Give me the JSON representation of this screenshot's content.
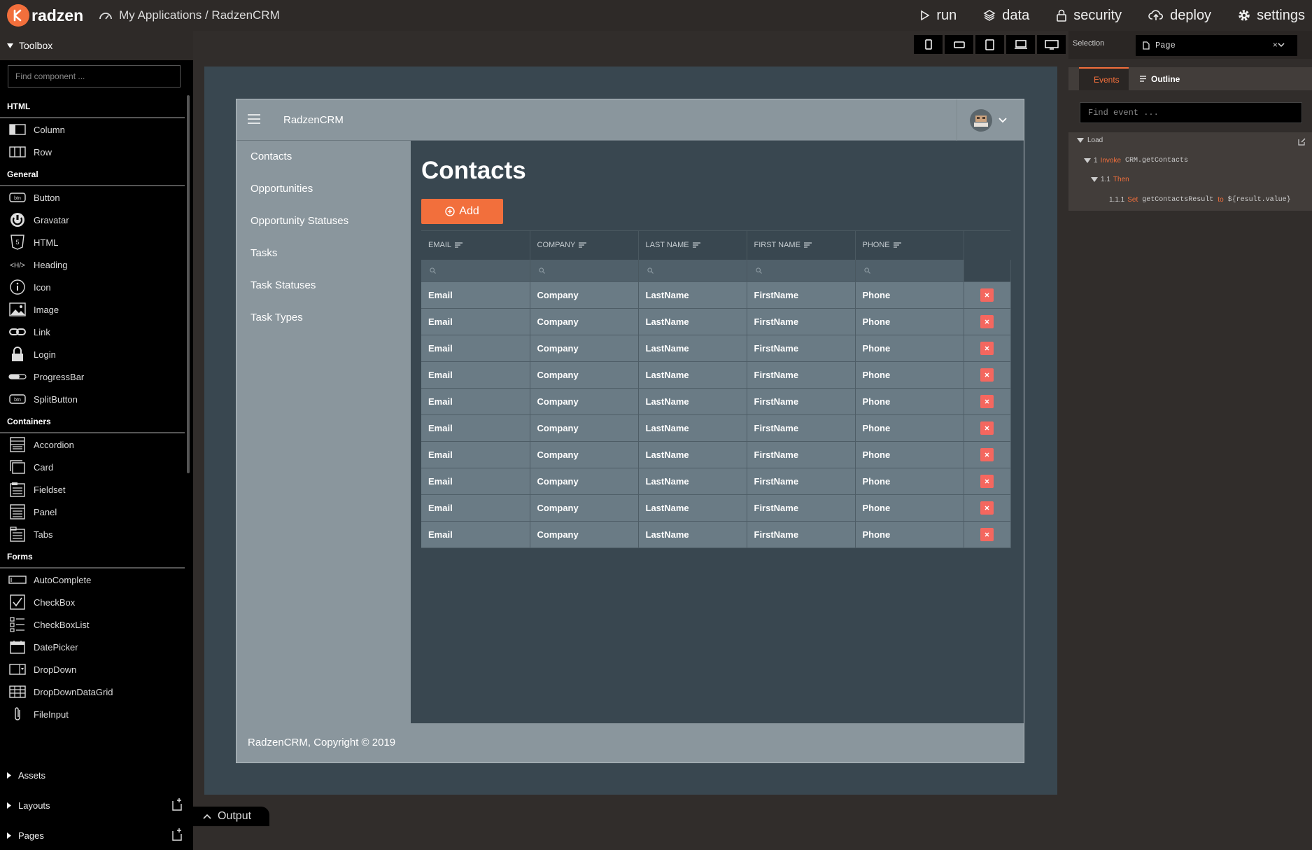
{
  "topbar": {
    "logo_text": "radzen",
    "breadcrumb": "My Applications / RadzenCRM",
    "nav": [
      {
        "label": "run",
        "icon": "play-icon"
      },
      {
        "label": "data",
        "icon": "layers-icon"
      },
      {
        "label": "security",
        "icon": "lock-icon"
      },
      {
        "label": "deploy",
        "icon": "cloud-upload-icon"
      },
      {
        "label": "settings",
        "icon": "gear-icon"
      }
    ]
  },
  "toolbox": {
    "title": "Toolbox",
    "search_placeholder": "Find component ...",
    "categories": [
      {
        "name": "HTML",
        "items": [
          "Column",
          "Row"
        ]
      },
      {
        "name": "General",
        "items": [
          "Button",
          "Gravatar",
          "HTML",
          "Heading",
          "Icon",
          "Image",
          "Link",
          "Login",
          "ProgressBar",
          "SplitButton"
        ]
      },
      {
        "name": "Containers",
        "items": [
          "Accordion",
          "Card",
          "Fieldset",
          "Panel",
          "Tabs"
        ]
      },
      {
        "name": "Forms",
        "items": [
          "AutoComplete",
          "CheckBox",
          "CheckBoxList",
          "DatePicker",
          "DropDown",
          "DropDownDataGrid",
          "FileInput"
        ]
      }
    ],
    "sections": [
      "Assets",
      "Layouts",
      "Pages"
    ]
  },
  "devices": [
    "phone-portrait-icon",
    "phone-landscape-icon",
    "tablet-icon",
    "laptop-icon",
    "desktop-icon"
  ],
  "app": {
    "title": "RadzenCRM",
    "nav": [
      "Contacts",
      "Opportunities",
      "Opportunity Statuses",
      "Tasks",
      "Task Statuses",
      "Task Types"
    ],
    "page_title": "Contacts",
    "add_label": "Add",
    "footer": "RadzenCRM, Copyright © 2019",
    "grid": {
      "columns": [
        "EMAIL",
        "COMPANY",
        "LAST NAME",
        "FIRST NAME",
        "PHONE"
      ],
      "row": [
        "Email",
        "Company",
        "LastName",
        "FirstName",
        "Phone"
      ],
      "row_count": 10
    }
  },
  "output_label": "Output",
  "right": {
    "selection_label": "Selection",
    "selection_value": "Page",
    "selection_clear": "×",
    "tabs": [
      "Events",
      "Outline"
    ],
    "find_event_placeholder": "Find event ...",
    "events": {
      "load": "Load",
      "step1_num": "1",
      "step1_kw": "Invoke",
      "step1_val": "CRM.getContacts",
      "step11_num": "1.1",
      "step11_kw": "Then",
      "step111_num": "1.1.1",
      "step111_kw": "Set",
      "step111_target": "getContactsResult",
      "step111_to": "to",
      "step111_val": "${result.value}"
    }
  }
}
